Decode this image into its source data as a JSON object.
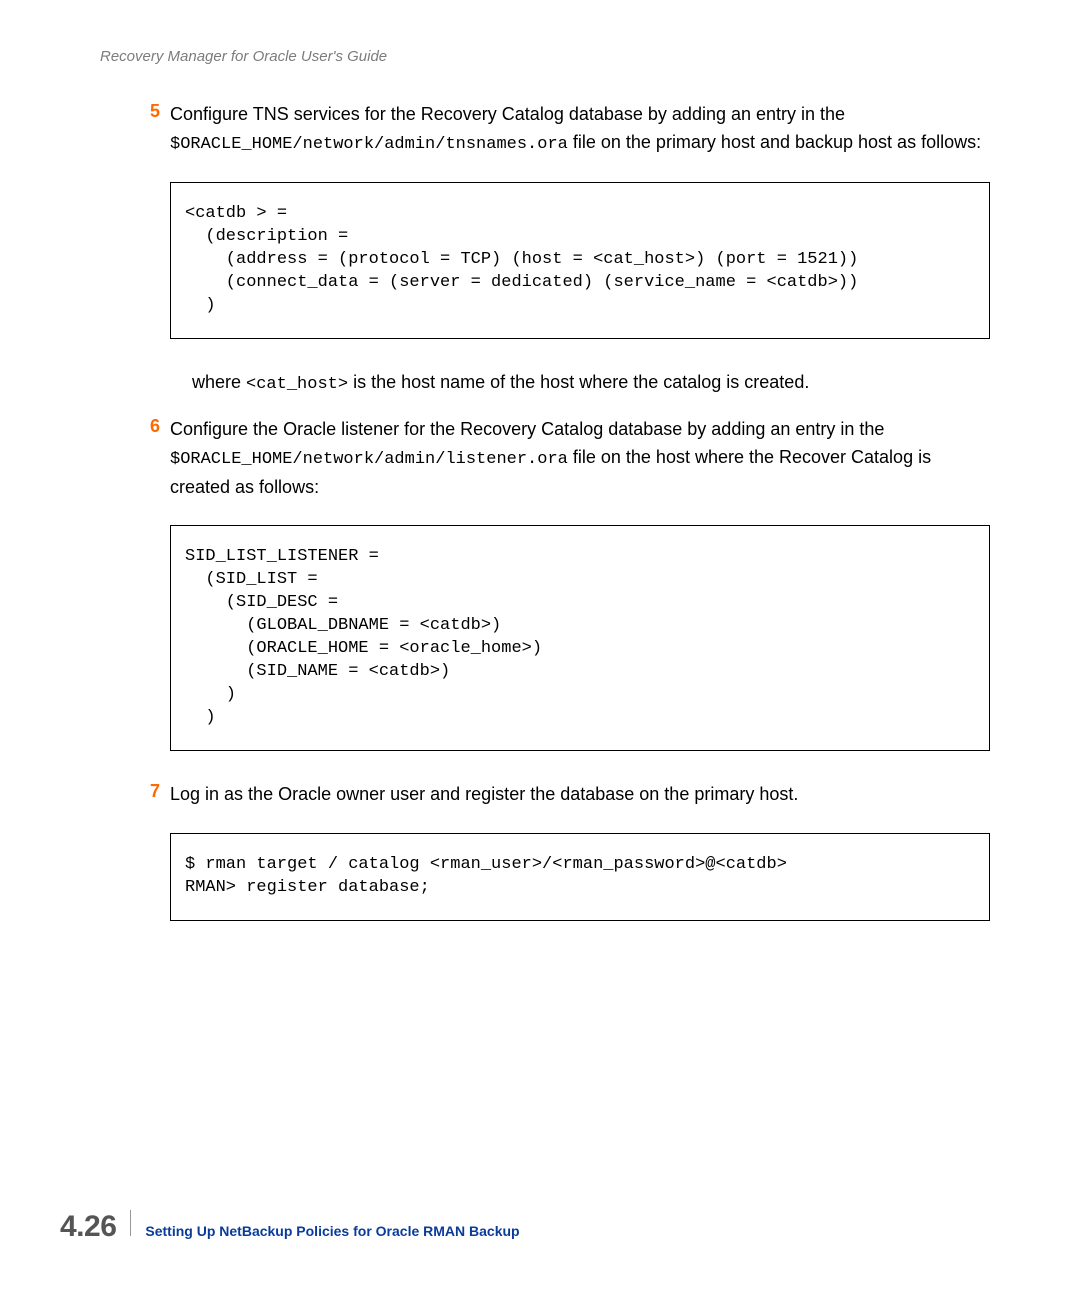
{
  "running_head": "Recovery Manager for Oracle User's Guide",
  "steps": {
    "s5": {
      "num": "5",
      "text_pre": "Configure TNS services for the Recovery Catalog database by adding an entry in the ",
      "mono1": "$ORACLE_HOME/network/admin/tnsnames.ora",
      "text_post": " file on the primary host and backup host as follows:",
      "code": "<catdb > =\n  (description =\n    (address = (protocol = TCP) (host = <cat_host>) (port = 1521))\n    (connect_data = (server = dedicated) (service_name = <catdb>))\n  )",
      "where_pre": "where ",
      "where_mono": "<cat_host>",
      "where_post": " is the host name of the host where the catalog is created."
    },
    "s6": {
      "num": "6",
      "text_pre": "Configure the Oracle listener for the Recovery Catalog database by adding an entry in the ",
      "mono1": "$ORACLE_HOME/network/admin/listener.ora",
      "text_post": " file on the host where the Recover Catalog is created as follows:",
      "code": "SID_LIST_LISTENER =\n  (SID_LIST =\n    (SID_DESC =\n      (GLOBAL_DBNAME = <catdb>)\n      (ORACLE_HOME = <oracle_home>)\n      (SID_NAME = <catdb>)\n    )\n  )"
    },
    "s7": {
      "num": "7",
      "text": "Log in as the Oracle owner user and register the database on the primary host.",
      "code": "$ rman target / catalog <rman_user>/<rman_password>@<catdb>\nRMAN> register database;"
    }
  },
  "footer": {
    "page_number": "4.26",
    "section_title": "Setting Up NetBackup Policies for Oracle RMAN Backup"
  }
}
